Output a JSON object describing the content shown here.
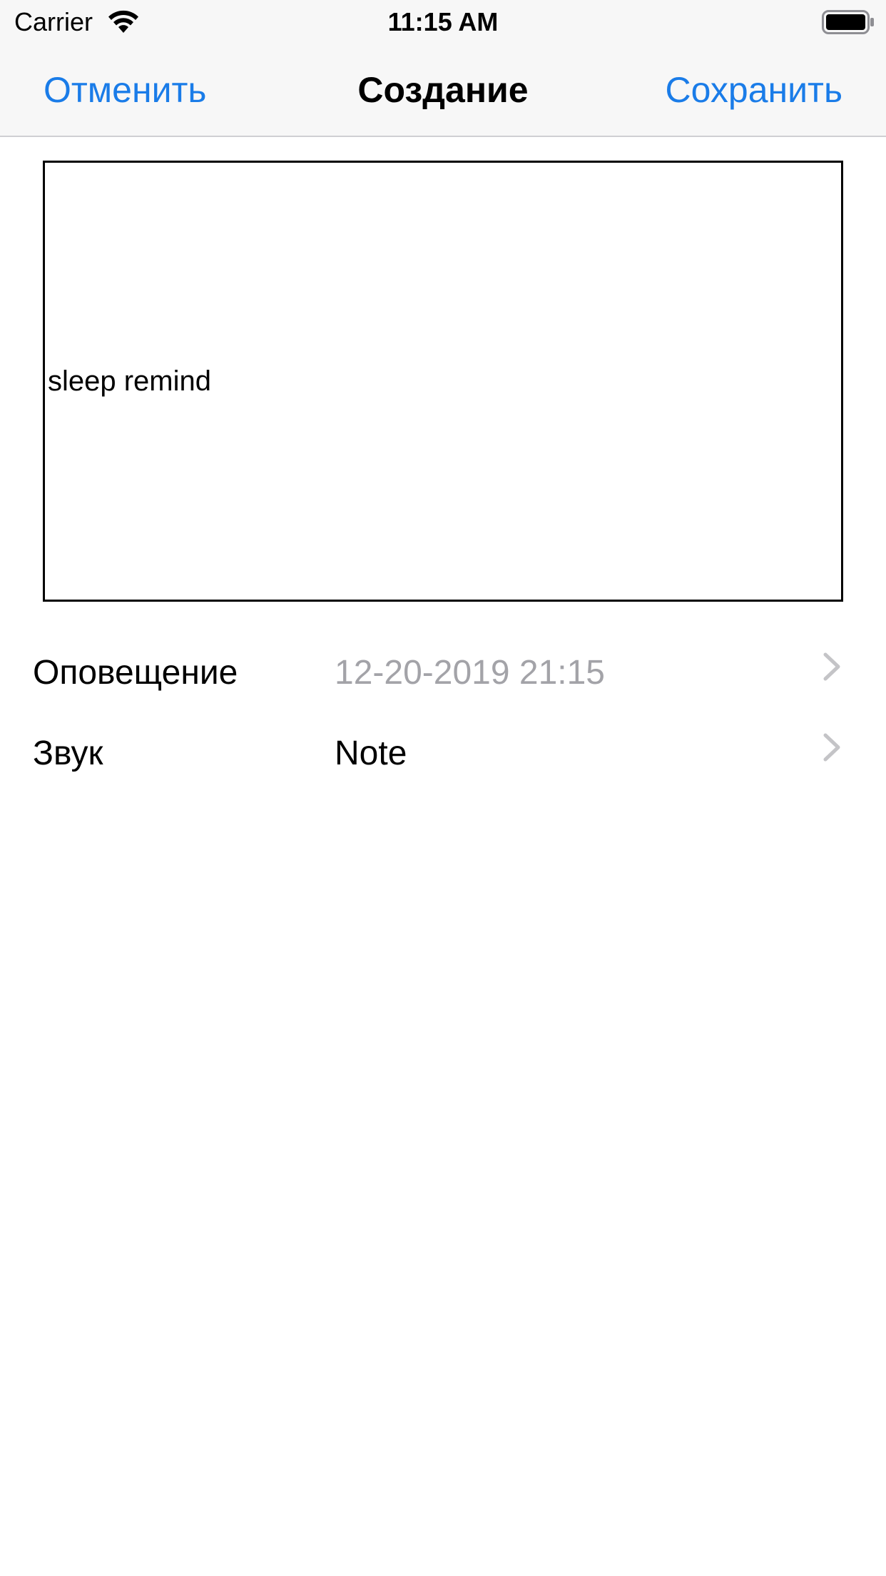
{
  "status_bar": {
    "carrier": "Carrier",
    "time": "11:15 AM",
    "icons": [
      "wifi-icon",
      "battery-icon"
    ]
  },
  "nav": {
    "cancel_label": "Отменить",
    "title": "Создание",
    "save_label": "Сохранить",
    "accent_color": "#1a7ce8"
  },
  "note": {
    "text": "sleep remind"
  },
  "settings": {
    "alert": {
      "label": "Оповещение",
      "value": "12-20-2019 21:15",
      "icon": "chevron-right-icon"
    },
    "sound": {
      "label": "Звук",
      "value": "Note",
      "icon": "chevron-right-icon"
    }
  }
}
